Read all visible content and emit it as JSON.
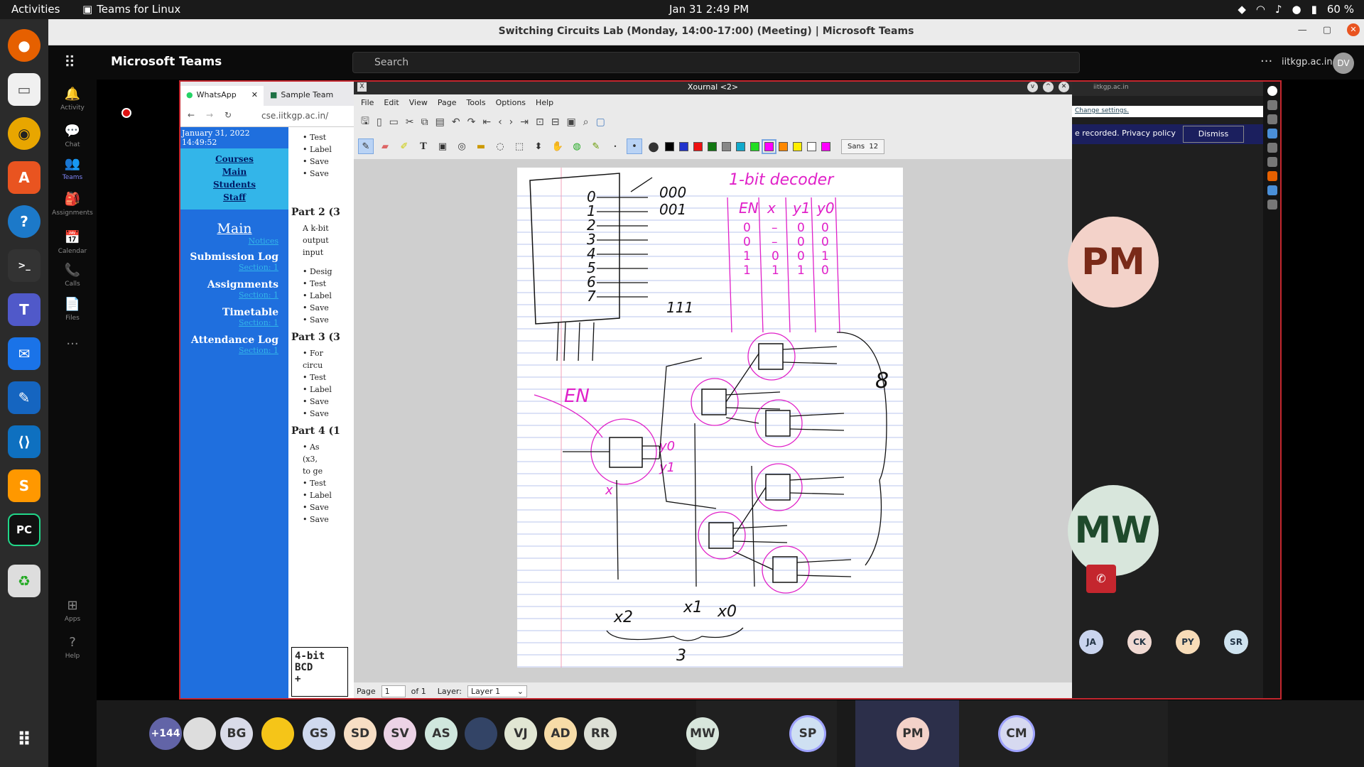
{
  "topbar": {
    "activities": "Activities",
    "app": "Teams for Linux",
    "clock": "Jan 31  2:49 PM",
    "battery": "60 %"
  },
  "window": {
    "title": "Switching Circuits Lab (Monday, 14:00-17:00) (Meeting) | Microsoft Teams"
  },
  "teams": {
    "brand": "Microsoft Teams",
    "search_placeholder": "Search",
    "org": "iitkgp.ac.in",
    "me": "DV"
  },
  "rail": [
    {
      "label": "Activity",
      "icon": "bell-icon"
    },
    {
      "label": "Chat",
      "icon": "chat-icon"
    },
    {
      "label": "Teams",
      "icon": "teams-icon"
    },
    {
      "label": "Assignments",
      "icon": "assignments-icon"
    },
    {
      "label": "Calendar",
      "icon": "calendar-icon"
    },
    {
      "label": "Calls",
      "icon": "phone-icon"
    },
    {
      "label": "Files",
      "icon": "file-icon"
    },
    {
      "label": "...",
      "icon": "more-icon"
    },
    {
      "label": "Apps",
      "icon": "apps-icon"
    },
    {
      "label": "Help",
      "icon": "help-icon"
    }
  ],
  "browser": {
    "tabs": [
      {
        "label": "WhatsApp"
      },
      {
        "label": "Sample Team"
      }
    ],
    "url": "cse.iitkgp.ac.in/",
    "date": "January 31, 2022 14:49:52",
    "nav_links": [
      "Courses",
      "Main",
      "Students",
      "Staff"
    ],
    "heading": "Main",
    "notices": "Notices",
    "sections": [
      {
        "label": "Submission Log",
        "sub": "Section: 1"
      },
      {
        "label": "Assignments",
        "sub": "Section: 1"
      },
      {
        "label": "Timetable",
        "sub": "Section: 1"
      },
      {
        "label": "Attendance Log",
        "sub": "Section: 1"
      }
    ],
    "parts": [
      "Part 2 (3",
      "Part 3 (3",
      "Part 4 (1"
    ],
    "code": [
      "4-bit",
      "BCD",
      "+"
    ]
  },
  "xournal": {
    "title": "Xournal <2>",
    "menus": [
      "File",
      "Edit",
      "View",
      "Page",
      "Tools",
      "Options",
      "Help"
    ],
    "font_label": "Sans",
    "font_size": "12",
    "page_label": "Page",
    "page_value": "1",
    "page_of": "of 1",
    "layer_label": "Layer:",
    "layer_value": "Layer 1",
    "pen_color": "#ff00ff",
    "palette": [
      "#000000",
      "#2233cc",
      "#ee1111",
      "#117711",
      "#888888",
      "#11aacc",
      "#22dd22",
      "#ff00ff",
      "#ff8800",
      "#ffee00",
      "#ffffff",
      "#ff00ff"
    ]
  },
  "notes": {
    "title": "1-bit decoder",
    "en": "EN",
    "table_headers": [
      "EN",
      "x",
      "y1",
      "y0"
    ],
    "rows": [
      [
        "0",
        "–",
        "0",
        "0"
      ],
      [
        "0",
        "–",
        "0",
        "0"
      ],
      [
        "1",
        "0",
        "0",
        "1"
      ],
      [
        "1",
        "1",
        "1",
        "0"
      ]
    ],
    "outs": [
      "000",
      "001",
      "111"
    ],
    "nums": [
      "0",
      "1",
      "2",
      "3",
      "4",
      "5",
      "6",
      "7"
    ],
    "inputs": [
      "x2",
      "x1",
      "x0"
    ],
    "count": "3",
    "eight": "8"
  },
  "meeting": {
    "ptop": "iitkgp.ac.in",
    "change": "Change settings.",
    "recorded": "e recorded. Privacy policy",
    "dismiss": "Dismiss",
    "big": [
      {
        "initials": "PM",
        "bg": "#f3d2c9",
        "fg": "#7a2a18"
      },
      {
        "initials": "MW",
        "bg": "#d8e6dc",
        "fg": "#1f4a2c"
      }
    ],
    "small": [
      {
        "initials": "JA",
        "bg": "#c9d4ee"
      },
      {
        "initials": "CK",
        "bg": "#f0d9d2"
      },
      {
        "initials": "PY",
        "bg": "#f7dcb8"
      },
      {
        "initials": "SR",
        "bg": "#cfe3ef"
      }
    ]
  },
  "bottom": [
    {
      "initials": "+144",
      "bg": "#6264a7",
      "fg": "#ffffff"
    },
    {
      "initials": "",
      "bg": "#dddddd",
      "fg": "#333333"
    },
    {
      "initials": "BG",
      "bg": "#d9dbe8",
      "fg": "#333333"
    },
    {
      "initials": "",
      "bg": "#f5c518",
      "fg": "#333333"
    },
    {
      "initials": "GS",
      "bg": "#cfd9ee",
      "fg": "#333333"
    },
    {
      "initials": "SD",
      "bg": "#f7dec4",
      "fg": "#333333"
    },
    {
      "initials": "SV",
      "bg": "#ecd3e6",
      "fg": "#333333"
    },
    {
      "initials": "AS",
      "bg": "#cfe7dd",
      "fg": "#333333"
    },
    {
      "initials": "",
      "bg": "#334466",
      "fg": "#ffffff"
    },
    {
      "initials": "VJ",
      "bg": "#e1e6d3",
      "fg": "#333333"
    },
    {
      "initials": "AD",
      "bg": "#f7dca7",
      "fg": "#333333"
    },
    {
      "initials": "RR",
      "bg": "#dde0d6",
      "fg": "#333333"
    },
    {
      "initials": "MW",
      "bg": "#d8e6dc",
      "fg": "#333333"
    },
    {
      "initials": "SP",
      "bg": "#cfe0f2",
      "fg": "#333333"
    },
    {
      "initials": "PM",
      "bg": "#f3d2c9",
      "fg": "#333333"
    },
    {
      "initials": "CM",
      "bg": "#d6d9f0",
      "fg": "#333333"
    }
  ]
}
